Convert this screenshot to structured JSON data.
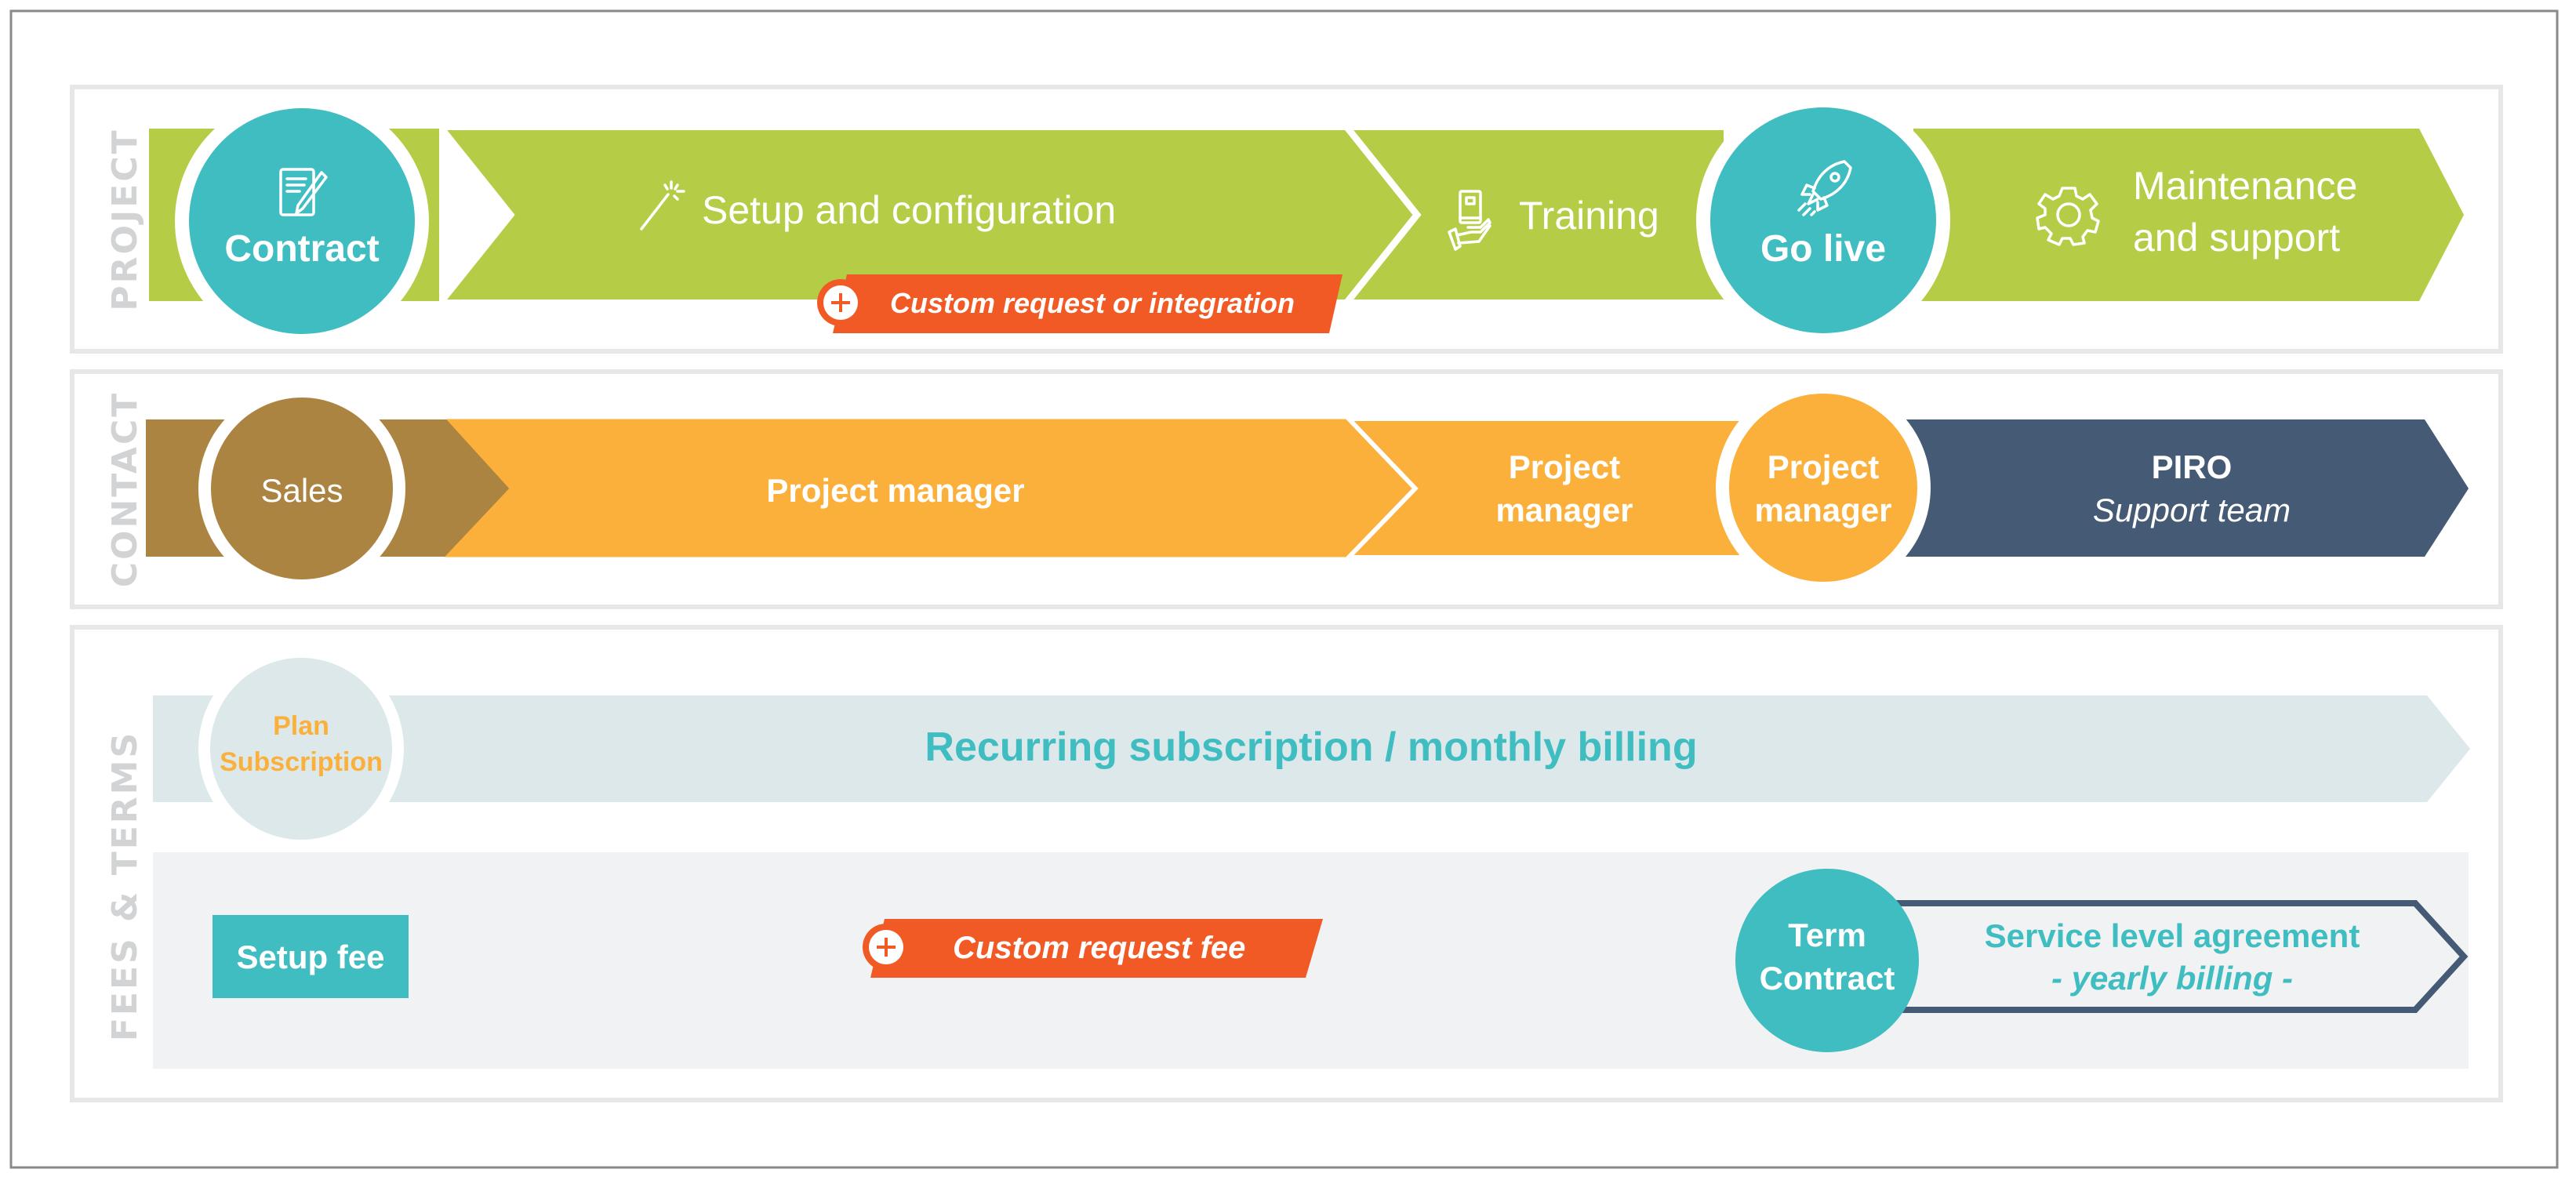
{
  "colors": {
    "green": "#b5cd46",
    "teal": "#40bdc1",
    "brown": "#ac8441",
    "orange": "#fbb03b",
    "navy": "#455a74",
    "red_orange": "#f15a24",
    "light_blue": "#dde8eb",
    "light_gray": "#f1f2f4",
    "label_gray": "#d1d3d4"
  },
  "project": {
    "section_label": "PROJECT",
    "contract": {
      "label": "Contract",
      "icon": "contract-pen-icon"
    },
    "setup": {
      "label": "Setup and configuration",
      "icon": "magic-wand-icon"
    },
    "custom_badge": {
      "label": "Custom request or integration",
      "icon": "plus-circle-icon"
    },
    "training": {
      "label": "Training",
      "icon": "book-hand-icon"
    },
    "go_live": {
      "label": "Go live",
      "icon": "rocket-icon"
    },
    "maintenance": {
      "line1": "Maintenance",
      "line2": "and support",
      "icon": "gear-icon"
    }
  },
  "contact": {
    "section_label": "CONTACT",
    "sales": {
      "label": "Sales"
    },
    "project_manager_1": {
      "label": "Project manager"
    },
    "project_manager_2": {
      "line1": "Project",
      "line2": "manager"
    },
    "project_manager_circle": {
      "line1": "Project",
      "line2": "manager"
    },
    "piro": {
      "line1": "PIRO",
      "line2": "Support team"
    }
  },
  "fees": {
    "section_label": "FEES & TERMS",
    "plan": {
      "line1": "Plan",
      "line2": "Subscription"
    },
    "recurring": {
      "label": "Recurring subscription / monthly billing"
    },
    "setup_fee": {
      "label": "Setup fee"
    },
    "custom_fee": {
      "label": "Custom request fee",
      "icon": "plus-circle-icon"
    },
    "term_contract": {
      "line1": "Term",
      "line2": "Contract"
    },
    "sla": {
      "line1": "Service level agreement",
      "line2": "- yearly billing -"
    }
  }
}
